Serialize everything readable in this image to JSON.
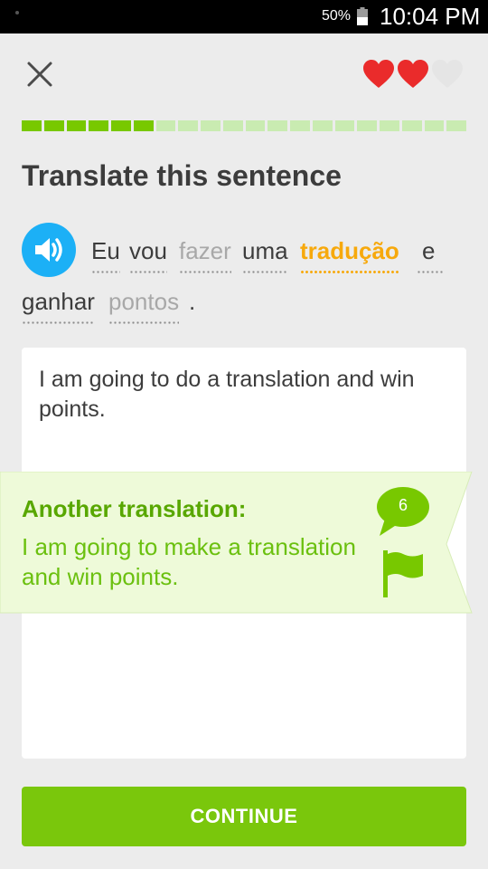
{
  "status_bar": {
    "battery_percent": "50%",
    "time": "10:04 PM"
  },
  "header": {
    "hearts": [
      {
        "state": "full",
        "color": "#ea2b2b"
      },
      {
        "state": "full",
        "color": "#ea2b2b"
      },
      {
        "state": "empty",
        "color": "#e5e5e5"
      }
    ],
    "progress": {
      "filled_segments": 6,
      "total_segments": 20,
      "fraction": 0.3,
      "filled_color": "#78c800",
      "empty_color": "#c9ebb1"
    }
  },
  "challenge": {
    "title": "Translate this sentence",
    "sentence_words": [
      {
        "text": "Eu",
        "style": "dark",
        "dotted": true
      },
      {
        "text": "vou",
        "style": "dark",
        "dotted": true
      },
      {
        "text": "fazer",
        "style": "light",
        "dotted": true
      },
      {
        "text": "uma",
        "style": "dark",
        "dotted": true
      },
      {
        "text": "tradução",
        "style": "highlight",
        "dotted": true
      },
      {
        "text": "e",
        "style": "dark",
        "dotted": true
      },
      {
        "text": "ganhar",
        "style": "dark",
        "dotted": true
      },
      {
        "text": "pontos",
        "style": "light",
        "dotted": true
      }
    ],
    "sentence_end": ".",
    "answer": "I am going to do a translation and win points."
  },
  "feedback": {
    "title": "Another translation:",
    "text": "I am going to make a translation and win points.",
    "discussion_count": "6"
  },
  "footer": {
    "continue_label": "CONTINUE",
    "button_color": "#7ac70c"
  }
}
